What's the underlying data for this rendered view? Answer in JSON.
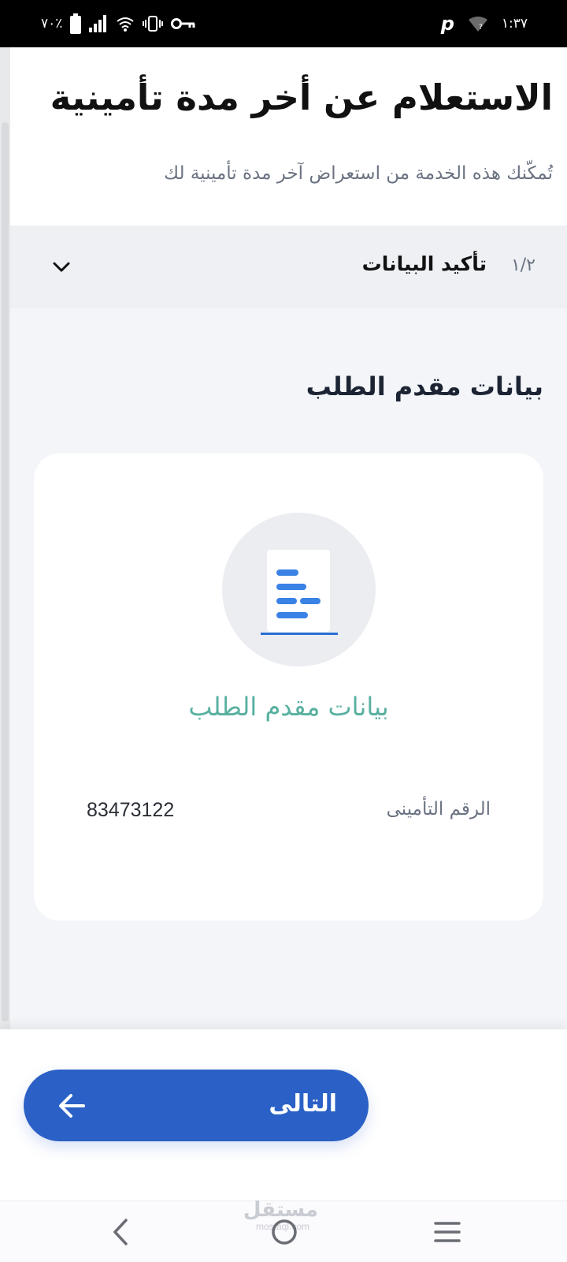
{
  "status_bar": {
    "battery_percent": "٧٠٪",
    "time": "١:٣٧",
    "icons": [
      "battery-icon",
      "signal-icon",
      "wifi-icon",
      "vibrate-icon",
      "vpn-key-icon",
      "p-app-icon",
      "wifi-unknown-icon"
    ]
  },
  "header": {
    "title": "الاستعلام عن أخر مدة تأمينية",
    "subtitle": "تُمكّنك هذه الخدمة من استعراض آخر مدة تأمينية لك"
  },
  "step": {
    "counter": "١/٢",
    "title": "تأكيد البيانات",
    "expanded": false
  },
  "section": {
    "title": "بيانات مقدم الطلب"
  },
  "card": {
    "icon": "document-icon",
    "title": "بيانات مقدم الطلب",
    "fields": [
      {
        "label": "الرقم التأمينى",
        "value": "83473122"
      }
    ]
  },
  "actions": {
    "next_label": "التالى"
  },
  "navbar": {
    "watermark_ar": "مستقل",
    "watermark_en": "mostaql.com"
  },
  "colors": {
    "primary": "#2b61c6",
    "accent_teal": "#58b0a0",
    "page_bg": "#f3f5f8",
    "step_bg": "#eef0f3"
  }
}
